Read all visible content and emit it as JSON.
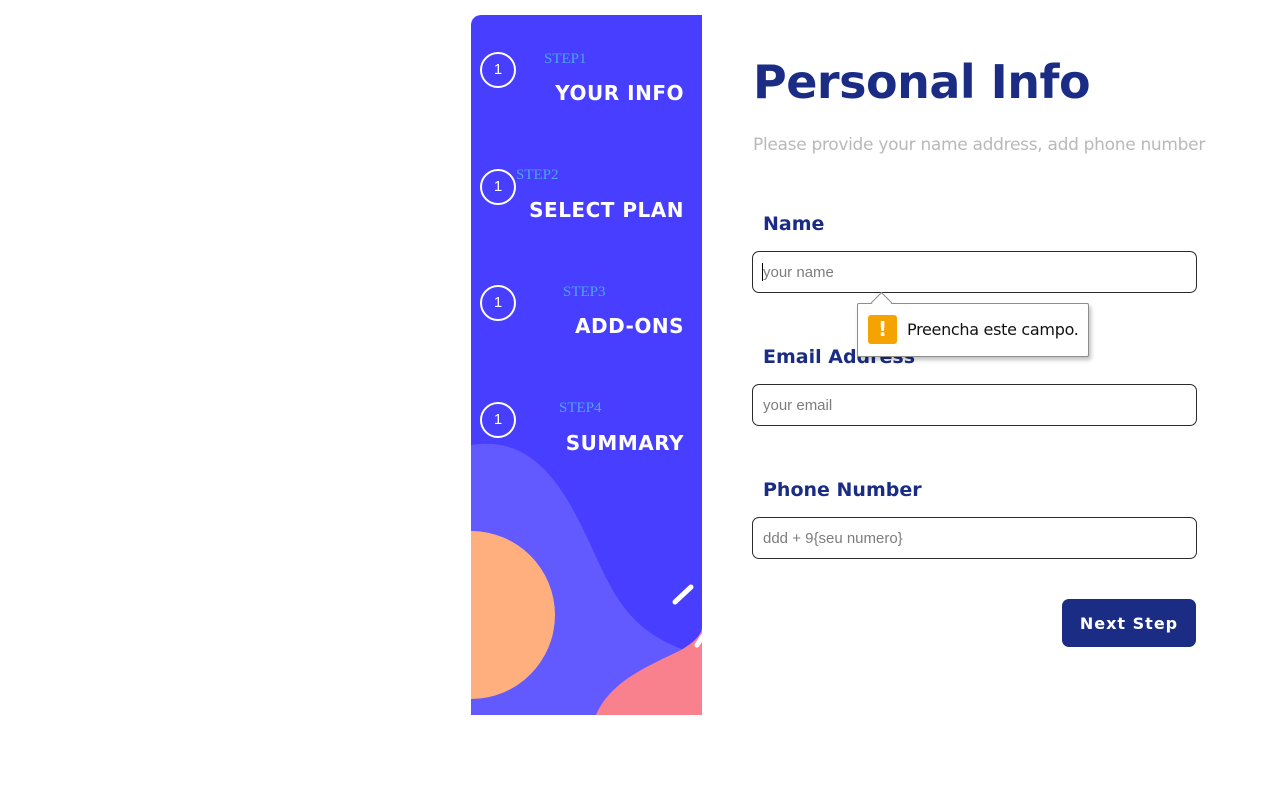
{
  "sidebar": {
    "steps": [
      {
        "number": "1",
        "sub": "STEP1",
        "title": "YOUR INFO"
      },
      {
        "number": "1",
        "sub": "STEP2",
        "title": "SELECT PLAN"
      },
      {
        "number": "1",
        "sub": "STEP3",
        "title": "ADD-ONS"
      },
      {
        "number": "1",
        "sub": "STEP4",
        "title": "SUMMARY"
      }
    ]
  },
  "main": {
    "title": "Personal Info",
    "subtitle": "Please provide your name address, add phone number",
    "fields": [
      {
        "label": "Name",
        "placeholder": "your name",
        "value": ""
      },
      {
        "label": "Email Address",
        "placeholder": "your email",
        "value": ""
      },
      {
        "label": "Phone Number",
        "placeholder": "ddd + 9{seu numero}",
        "value": ""
      }
    ],
    "validation_tooltip": {
      "text": "Preencha este campo.",
      "icon": "warning-icon"
    },
    "next_button": "Next Step"
  },
  "colors": {
    "sidebar_bg": "#483eff",
    "accent_dark": "#1b2c85",
    "step_sub": "#4fa3e8",
    "blob_orange": "#ffaf7e",
    "blob_pink": "#f9818e",
    "blob_purple": "#6259ff",
    "warning": "#f5a300"
  }
}
